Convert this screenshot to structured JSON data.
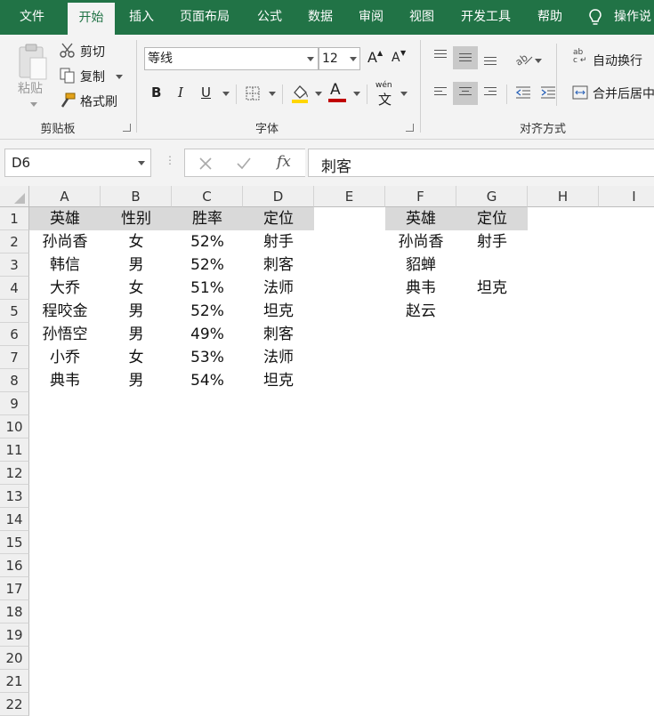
{
  "tabs": [
    "文件",
    "开始",
    "插入",
    "页面布局",
    "公式",
    "数据",
    "审阅",
    "视图",
    "开发工具",
    "帮助",
    "操作说"
  ],
  "active_tab": "开始",
  "clipboard": {
    "paste": "粘贴",
    "cut": "剪切",
    "copy": "复制",
    "format_painter": "格式刷",
    "group_label": "剪贴板"
  },
  "font": {
    "name": "等线",
    "size": "12",
    "grow": "A",
    "shrink": "A",
    "bold": "B",
    "italic": "I",
    "underline": "U",
    "font_color": "A",
    "phonetic": "wén",
    "phonetic_char": "文",
    "group_label": "字体"
  },
  "alignment": {
    "wrap_text": "自动换行",
    "wrap_glyph": "ab",
    "wrap_glyph2": "c",
    "merge_center": "合并后居中",
    "group_label": "对齐方式"
  },
  "formula_bar": {
    "name_box": "D6",
    "fx": "fx",
    "content": "刺客"
  },
  "columns": [
    "A",
    "B",
    "C",
    "D",
    "E",
    "F",
    "G",
    "H",
    "I"
  ],
  "rows": [
    "1",
    "2",
    "3",
    "4",
    "5",
    "6",
    "7",
    "8",
    "9",
    "10",
    "11",
    "12",
    "13",
    "14",
    "15",
    "16",
    "17",
    "18",
    "19",
    "20",
    "21",
    "22"
  ],
  "table_left": {
    "headers": [
      "英雄",
      "性别",
      "胜率",
      "定位"
    ],
    "rows": [
      [
        "孙尚香",
        "女",
        "52%",
        "射手"
      ],
      [
        "韩信",
        "男",
        "52%",
        "刺客"
      ],
      [
        "大乔",
        "女",
        "51%",
        "法师"
      ],
      [
        "程咬金",
        "男",
        "52%",
        "坦克"
      ],
      [
        "孙悟空",
        "男",
        "49%",
        "刺客"
      ],
      [
        "小乔",
        "女",
        "53%",
        "法师"
      ],
      [
        "典韦",
        "男",
        "54%",
        "坦克"
      ]
    ]
  },
  "table_right": {
    "headers": [
      "英雄",
      "定位"
    ],
    "rows": [
      [
        "孙尚香",
        "射手"
      ],
      [
        "貂蝉",
        ""
      ],
      [
        "典韦",
        "坦克"
      ],
      [
        "赵云",
        ""
      ]
    ]
  },
  "colors": {
    "ribbon_green": "#217346",
    "header_fill": "#d9d9d9",
    "highlight_yellow": "#ffd600",
    "font_red": "#c00000"
  }
}
